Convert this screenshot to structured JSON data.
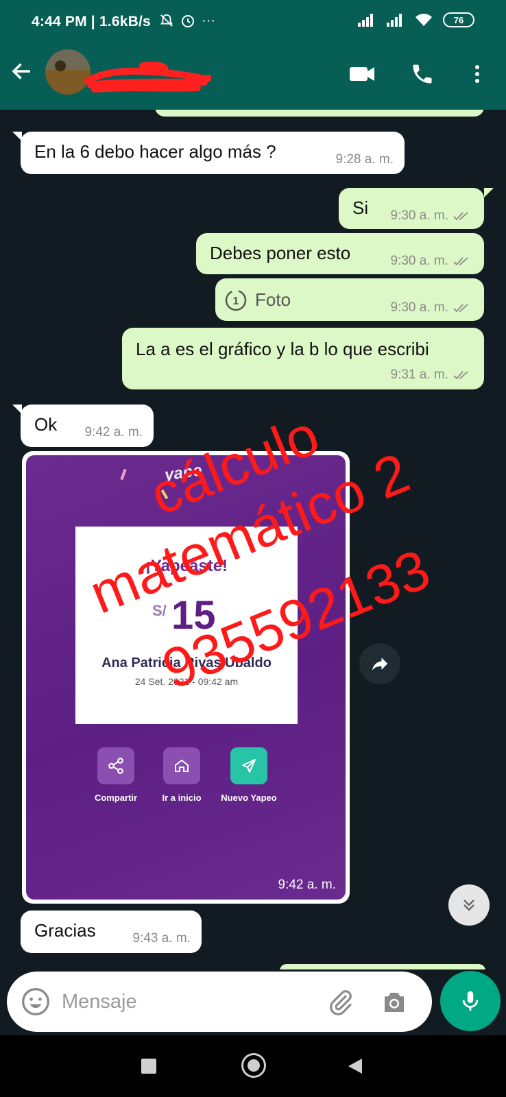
{
  "status_bar": {
    "time": "4:44 PM | 1.6kB/s",
    "battery": "76"
  },
  "header": {
    "back_icon": "arrow-left-icon",
    "video_icon": "video-call-icon",
    "call_icon": "phone-icon",
    "menu_icon": "more-vert-icon"
  },
  "messages": [
    {
      "dir": "in",
      "text": "En la 6 debo hacer algo más ?",
      "time": "9:28 a. m."
    },
    {
      "dir": "out",
      "text": "Si",
      "time": "9:30 a. m."
    },
    {
      "dir": "out",
      "text": "Debes poner esto",
      "time": "9:30 a. m."
    },
    {
      "dir": "out",
      "text": "Foto",
      "time": "9:30 a. m."
    },
    {
      "dir": "out",
      "text": "La a es el gráfico y la b lo que escribi",
      "time": "9:31 a. m."
    },
    {
      "dir": "in",
      "text": "Ok",
      "time": "9:42 a. m."
    },
    {
      "dir": "in",
      "text": "Gracias",
      "time": "9:43 a. m."
    }
  ],
  "image_message": {
    "time": "9:42 a. m.",
    "title": "¡Yapeaste!",
    "currency": "S/",
    "amount": "15",
    "name": "Ana Patricia Rivas Ubaldo",
    "date": "24 Set. 2021 - 09:42 am",
    "logo": "yape",
    "actions": [
      {
        "label": "Compartir",
        "icon": "share-icon"
      },
      {
        "label": "Ir a inicio",
        "icon": "home-icon"
      },
      {
        "label": "Nuevo Yapeo",
        "icon": "send-icon"
      }
    ]
  },
  "watermark": {
    "line1": "cálculo",
    "line2": "matemático 2",
    "line3": "935592133",
    "color": "#ff1a1a"
  },
  "input": {
    "placeholder": "Mensaje"
  },
  "colors": {
    "header": "#075e54",
    "outgoing": "#dcf8c6",
    "incoming": "#ffffff",
    "mic": "#00a884"
  }
}
